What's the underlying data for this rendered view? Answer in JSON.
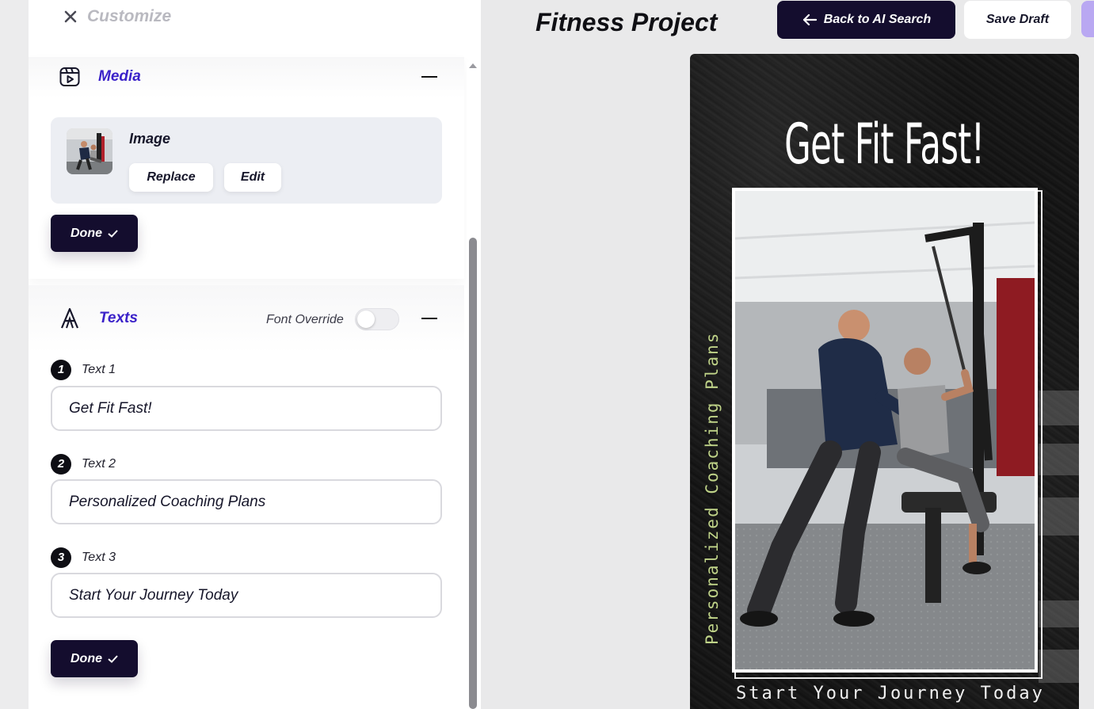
{
  "sidebar": {
    "header_title": "Customize",
    "media": {
      "title": "Media",
      "item_label": "Image",
      "replace_label": "Replace",
      "edit_label": "Edit",
      "done_label": "Done"
    },
    "texts": {
      "title": "Texts",
      "font_override_label": "Font Override",
      "font_override_on": false,
      "fields": [
        {
          "number": "1",
          "label": "Text 1",
          "value": "Get Fit Fast!"
        },
        {
          "number": "2",
          "label": "Text 2",
          "value": "Personalized Coaching Plans"
        },
        {
          "number": "3",
          "label": "Text 3",
          "value": "Start Your Journey Today"
        }
      ],
      "done_label": "Done"
    }
  },
  "topbar": {
    "project_title": "Fitness Project",
    "back_label": "Back to AI Search",
    "save_label": "Save Draft"
  },
  "poster": {
    "headline": "Get Fit Fast!",
    "side_text": "Personalized Coaching Plans",
    "bottom_text": "Start Your Journey Today"
  },
  "colors": {
    "accent": "#3b22c9",
    "dark_button": "#140d2e",
    "poster_side_text": "#bfd388"
  },
  "icons": {
    "close": "close-icon",
    "media": "media-icon",
    "texts": "font-icon",
    "back": "arrow-left-icon",
    "check": "check-icon"
  }
}
